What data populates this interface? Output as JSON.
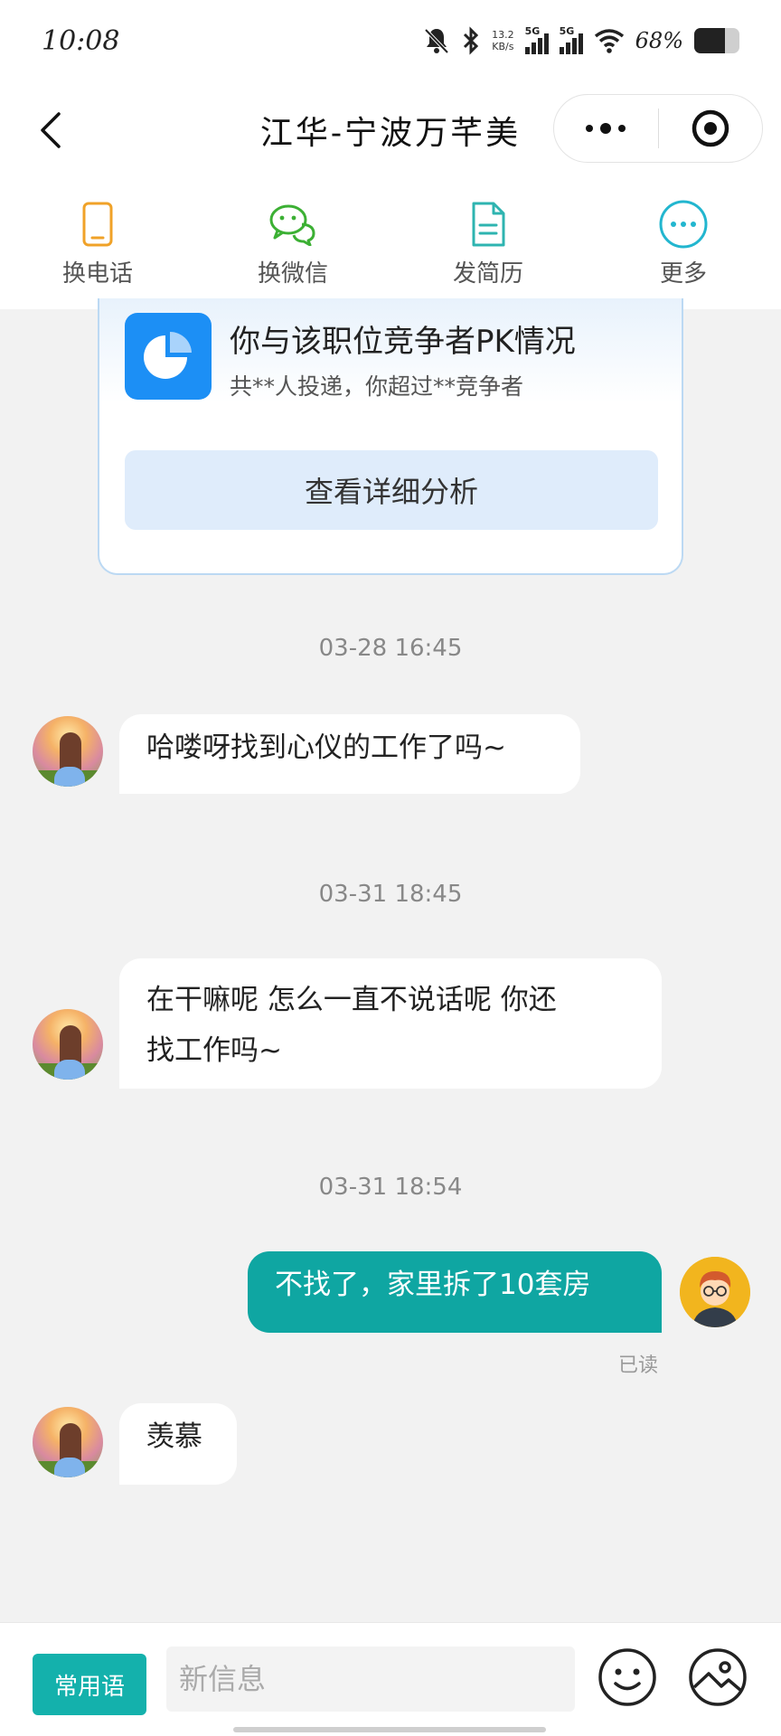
{
  "status_bar": {
    "time": "10:08",
    "net_speed_value": "13.2",
    "net_speed_unit": "KB/s",
    "signal1_label": "5G",
    "signal2_label": "5G",
    "battery_text": "68%",
    "battery_level": 0.68,
    "icons": [
      "mute-bell-icon",
      "bluetooth-icon",
      "signal-icon",
      "signal-icon",
      "wifi-icon",
      "battery-icon"
    ]
  },
  "header": {
    "title": "江华-宁波万芊美",
    "back_icon": "chevron-left-icon",
    "more_icon": "more-dots-icon",
    "target_icon": "target-icon"
  },
  "actions": [
    {
      "label": "换电话",
      "icon": "phone-icon",
      "color": "#f0a228"
    },
    {
      "label": "换微信",
      "icon": "wechat-icon",
      "color": "#3cb034"
    },
    {
      "label": "发简历",
      "icon": "document-icon",
      "color": "#2eb4b0"
    },
    {
      "label": "更多",
      "icon": "more-circle-icon",
      "color": "#22b6cf"
    }
  ],
  "pk_card": {
    "icon": "pie-chart-icon",
    "title": "你与该职位竞争者PK情况",
    "subtitle": "共**人投递，你超过**竞争者",
    "button": "查看详细分析"
  },
  "messages": [
    {
      "timestamp": "03-28 16:45",
      "side": "left",
      "text": "哈喽呀找到心仪的工作了吗~"
    },
    {
      "timestamp": "03-31 18:45",
      "side": "left",
      "lines": [
        "在干嘛呢 怎么一直不说话呢 你还",
        "找工作吗~"
      ]
    },
    {
      "timestamp": "03-31 18:54",
      "side": "right",
      "text": "不找了，家里拆了10套房",
      "status": "已读"
    },
    {
      "side": "left",
      "text": "羡慕"
    }
  ],
  "input_bar": {
    "common_phrases": "常用语",
    "placeholder": "新信息",
    "emoji_icon": "emoji-smile-icon",
    "image_icon": "image-icon"
  },
  "colors": {
    "accent": "#0fa6a2",
    "pk_blue": "#1c8ff5"
  }
}
